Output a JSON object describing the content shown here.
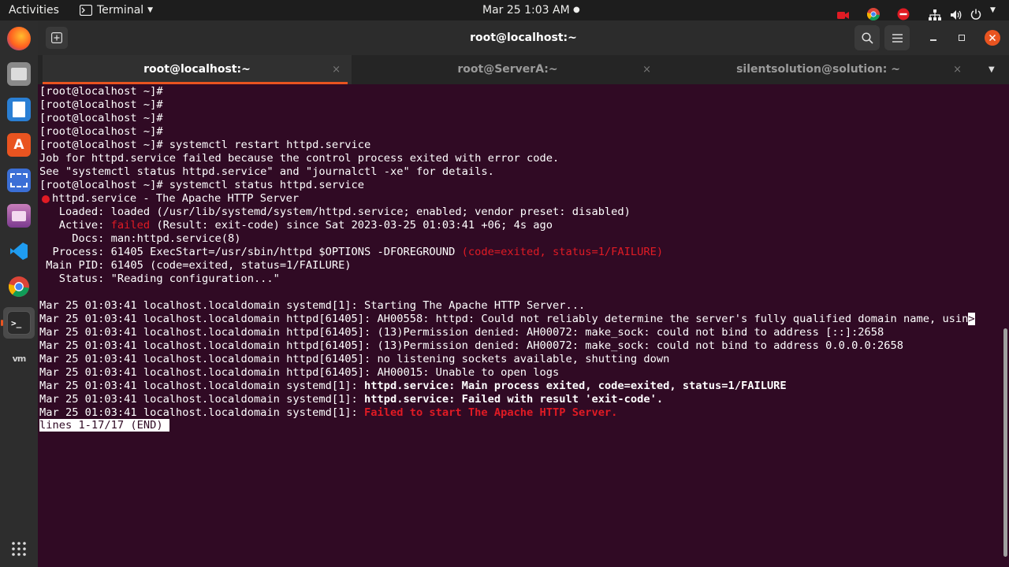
{
  "topbar": {
    "activities": "Activities",
    "app_name": "Terminal",
    "clock": "Mar 25  1:03 AM"
  },
  "window": {
    "title": "root@localhost:~"
  },
  "tabs": [
    {
      "label": "root@localhost:~",
      "close": "×"
    },
    {
      "label": "root@ServerA:~",
      "close": "×"
    },
    {
      "label": "silentsolution@solution: ~",
      "close": "×"
    }
  ],
  "terminal": {
    "lines": [
      "[root@localhost ~]#",
      "[root@localhost ~]#",
      "[root@localhost ~]#",
      "[root@localhost ~]#",
      "[root@localhost ~]# systemctl restart httpd.service",
      "Job for httpd.service failed because the control process exited with error code.",
      "See \"systemctl status httpd.service\" and \"journalctl -xe\" for details.",
      "[root@localhost ~]# systemctl status httpd.service",
      "httpd.service - The Apache HTTP Server",
      "   Loaded: loaded (/usr/lib/systemd/system/httpd.service; enabled; vendor preset: disabled)",
      "   Active: ",
      "failed",
      " (Result: exit-code) since Sat 2023-03-25 01:03:41 +06; 4s ago",
      "     Docs: man:httpd.service(8)",
      "  Process: 61405 ExecStart=/usr/sbin/httpd $OPTIONS -DFOREGROUND ",
      "(code=exited, status=1/FAILURE)",
      " Main PID: 61405 (code=exited, status=1/FAILURE)",
      "   Status: \"Reading configuration...\"",
      "Mar 25 01:03:41 localhost.localdomain systemd[1]: Starting The Apache HTTP Server...",
      "Mar 25 01:03:41 localhost.localdomain httpd[61405]: AH00558: httpd: Could not reliably determine the server's fully qualified domain name, usin",
      ">",
      "Mar 25 01:03:41 localhost.localdomain httpd[61405]: (13)Permission denied: AH00072: make_sock: could not bind to address [::]:2658",
      "Mar 25 01:03:41 localhost.localdomain httpd[61405]: (13)Permission denied: AH00072: make_sock: could not bind to address 0.0.0.0:2658",
      "Mar 25 01:03:41 localhost.localdomain httpd[61405]: no listening sockets available, shutting down",
      "Mar 25 01:03:41 localhost.localdomain httpd[61405]: AH00015: Unable to open logs",
      "Mar 25 01:03:41 localhost.localdomain systemd[1]: ",
      "httpd.service: Main process exited, code=exited, status=1/FAILURE",
      "Mar 25 01:03:41 localhost.localdomain systemd[1]: ",
      "httpd.service: Failed with result 'exit-code'.",
      "Mar 25 01:03:41 localhost.localdomain systemd[1]: ",
      "Failed to start The Apache HTTP Server.",
      "lines 1-17/17 (END)"
    ]
  },
  "colors": {
    "terminal_bg": "#300a24",
    "error_red": "#e01b24",
    "tab_accent": "#e95420"
  },
  "icons": {
    "dock": [
      "firefox-icon",
      "files-icon",
      "writer-icon",
      "software-icon",
      "screenshot-icon",
      "video-icon",
      "vscode-icon",
      "chrome-icon",
      "terminal-icon",
      "vmware-icon",
      "app-grid-icon"
    ],
    "tray": [
      "camera-icon",
      "chrome-icon",
      "do-not-disturb-icon",
      "network-icon",
      "volume-icon",
      "power-icon",
      "chevron-down-icon"
    ]
  }
}
